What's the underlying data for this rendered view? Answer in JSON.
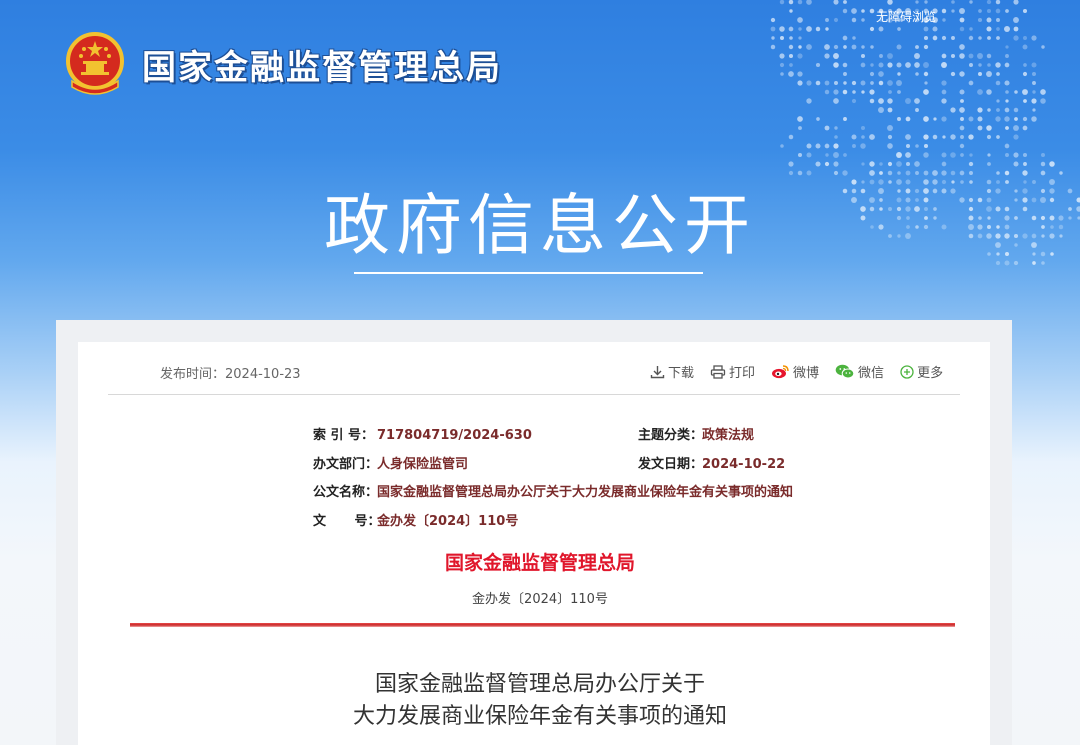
{
  "header": {
    "accessibility_link": "无障碍浏览",
    "site_name": "国家金融监督管理总局",
    "section_title": "政府信息公开"
  },
  "article": {
    "publish_time_label": "发布时间：",
    "publish_time": "2024-10-23",
    "actions": {
      "download": "下载",
      "print": "打印",
      "weibo": "微博",
      "wechat": "微信",
      "more": "更多"
    },
    "meta": {
      "index_label": "索 引 号：",
      "index_value": "717804719/2024-630",
      "topic_label": "主题分类：",
      "topic_value": "政策法规",
      "dept_label": "办文部门：",
      "dept_value": "人身保险监管司",
      "date_label": "发文日期：",
      "date_value": "2024-10-22",
      "name_label": "公文名称：",
      "name_value": "国家金融监督管理总局办公厅关于大力发展商业保险年金有关事项的通知",
      "docno_label": "文 号：",
      "docno_value": "金办发〔2024〕110号"
    },
    "issuer": "国家金融监督管理总局",
    "doc_number": "金办发〔2024〕110号",
    "title_line1": "国家金融监督管理总局办公厅关于",
    "title_line2": "大力发展商业保险年金有关事项的通知"
  },
  "colors": {
    "banner_blue": "#2f7fe0",
    "issuer_red": "#e0162b",
    "meta_value": "#7a2b2b"
  }
}
